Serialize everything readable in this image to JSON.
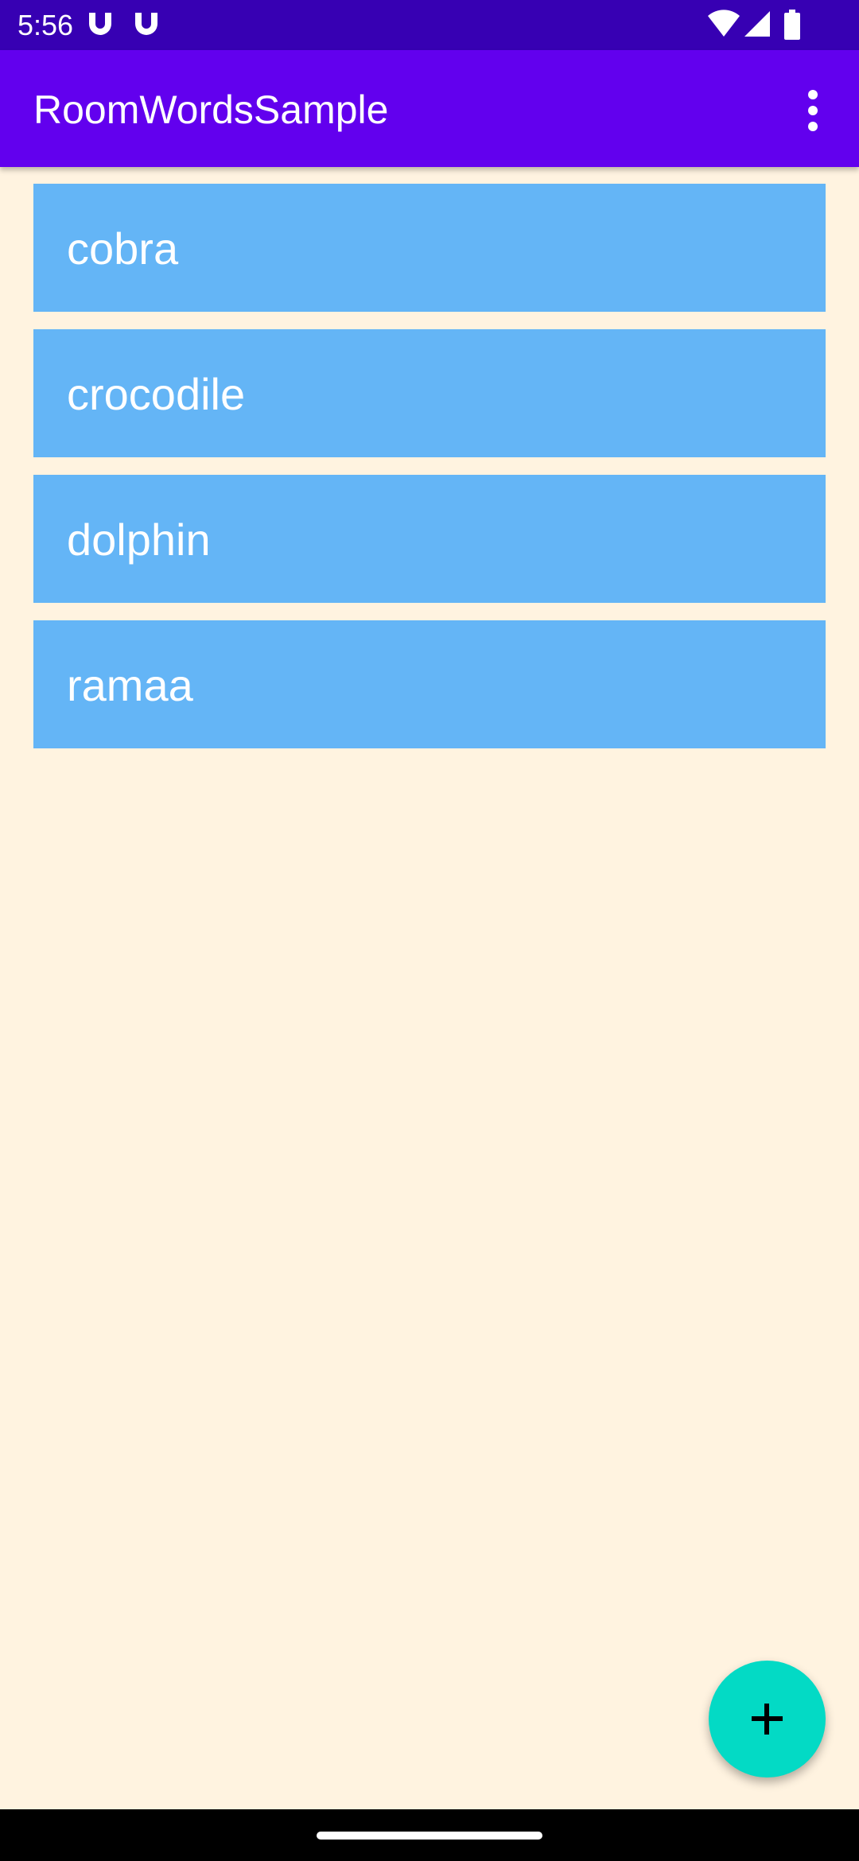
{
  "status_bar": {
    "time": "5:56",
    "background": "#3700B3",
    "notification_icons": [
      "magnet-notification-icon",
      "magnet-notification-icon"
    ],
    "system_icons": [
      "wifi-icon",
      "cell-signal-icon",
      "battery-icon"
    ]
  },
  "app_bar": {
    "title": "RoomWordsSample",
    "background": "#6200EE",
    "overflow_icon": "more-vert-icon"
  },
  "word_list": {
    "item_color": "#64B5F6",
    "items": [
      "cobra",
      "crocodile",
      "dolphin",
      "ramaa"
    ]
  },
  "fab": {
    "icon": "add-icon",
    "color": "#03DAC5"
  },
  "page": {
    "background": "#FFF3E0"
  }
}
